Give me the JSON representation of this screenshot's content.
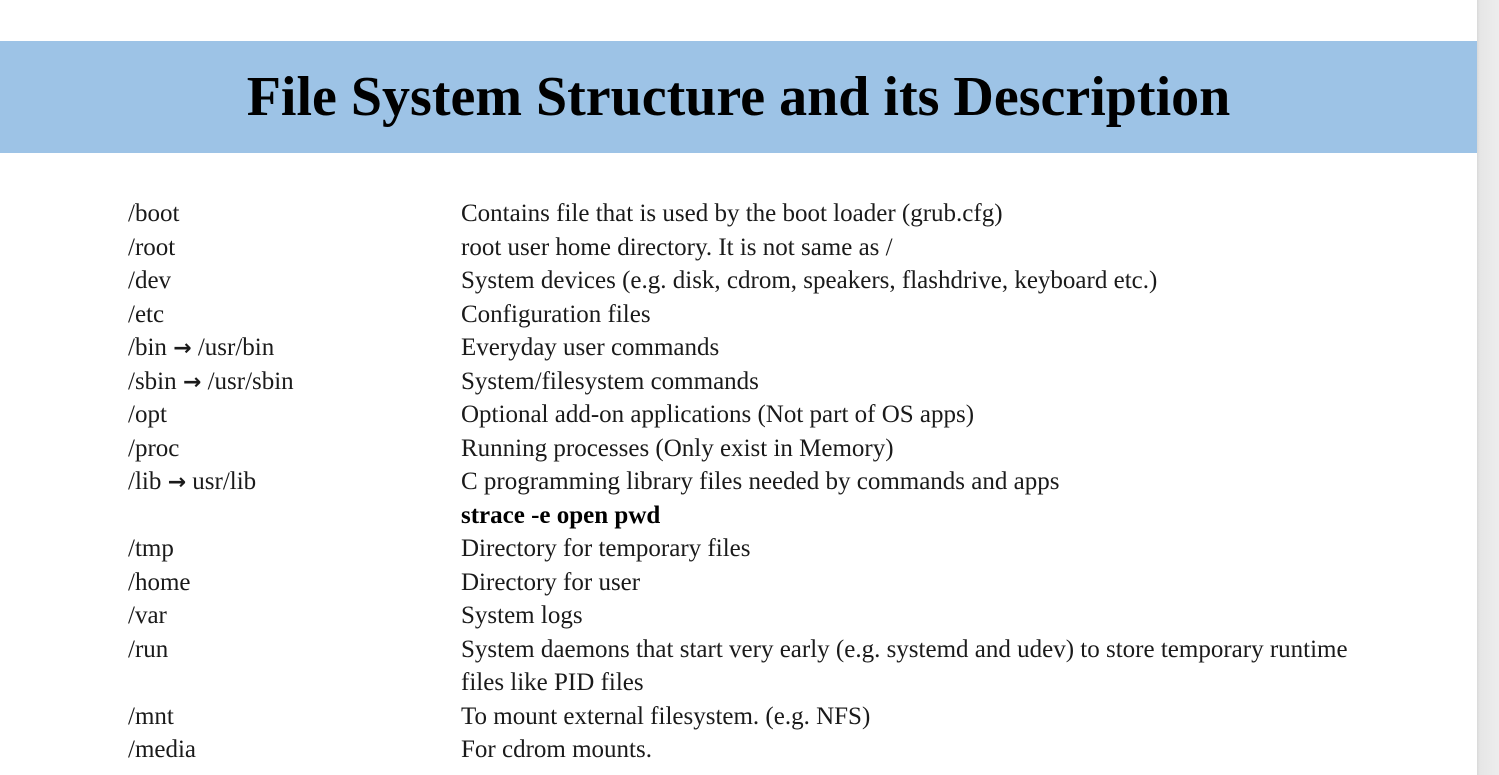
{
  "title": "File System Structure and its Description",
  "rows": [
    {
      "path": "/boot",
      "desc": "Contains file that is used by the boot loader (grub.cfg)"
    },
    {
      "path": "/root",
      "desc": "root user home directory.  It is not same as /"
    },
    {
      "path": "/dev",
      "desc": "System devices (e.g. disk, cdrom, speakers, flashdrive, keyboard etc.)"
    },
    {
      "path": "/etc",
      "desc": "Configuration files"
    },
    {
      "path_from": "/bin",
      "arrow": "→",
      "path_to": "/usr/bin",
      "desc": "Everyday user commands"
    },
    {
      "path_from": "/sbin",
      "arrow": "→",
      "path_to": "/usr/sbin",
      "desc": "System/filesystem commands"
    },
    {
      "path": "/opt",
      "desc": "Optional add-on applications (Not part of OS apps)"
    },
    {
      "path": "/proc",
      "desc": "Running processes (Only exist in Memory)"
    },
    {
      "path_from": "/lib",
      "arrow": "→",
      "path_to": "usr/lib",
      "desc": "C programming library files needed by commands and apps"
    },
    {
      "path": "",
      "desc": "strace -e open pwd"
    },
    {
      "path": "/tmp",
      "desc": "Directory for temporary files"
    },
    {
      "path": "/home",
      "desc": "Directory for user"
    },
    {
      "path": "/var",
      "desc": "System logs"
    },
    {
      "path": "/run",
      "desc": "System daemons that start very early (e.g. systemd and udev) to store temporary runtime files like PID files"
    },
    {
      "path": "/mnt",
      "desc": "To mount external filesystem. (e.g. NFS)"
    },
    {
      "path": "/media",
      "desc": "For cdrom mounts."
    }
  ],
  "colors": {
    "title_bar": "#9dc3e6",
    "text": "#1a1a1a"
  }
}
